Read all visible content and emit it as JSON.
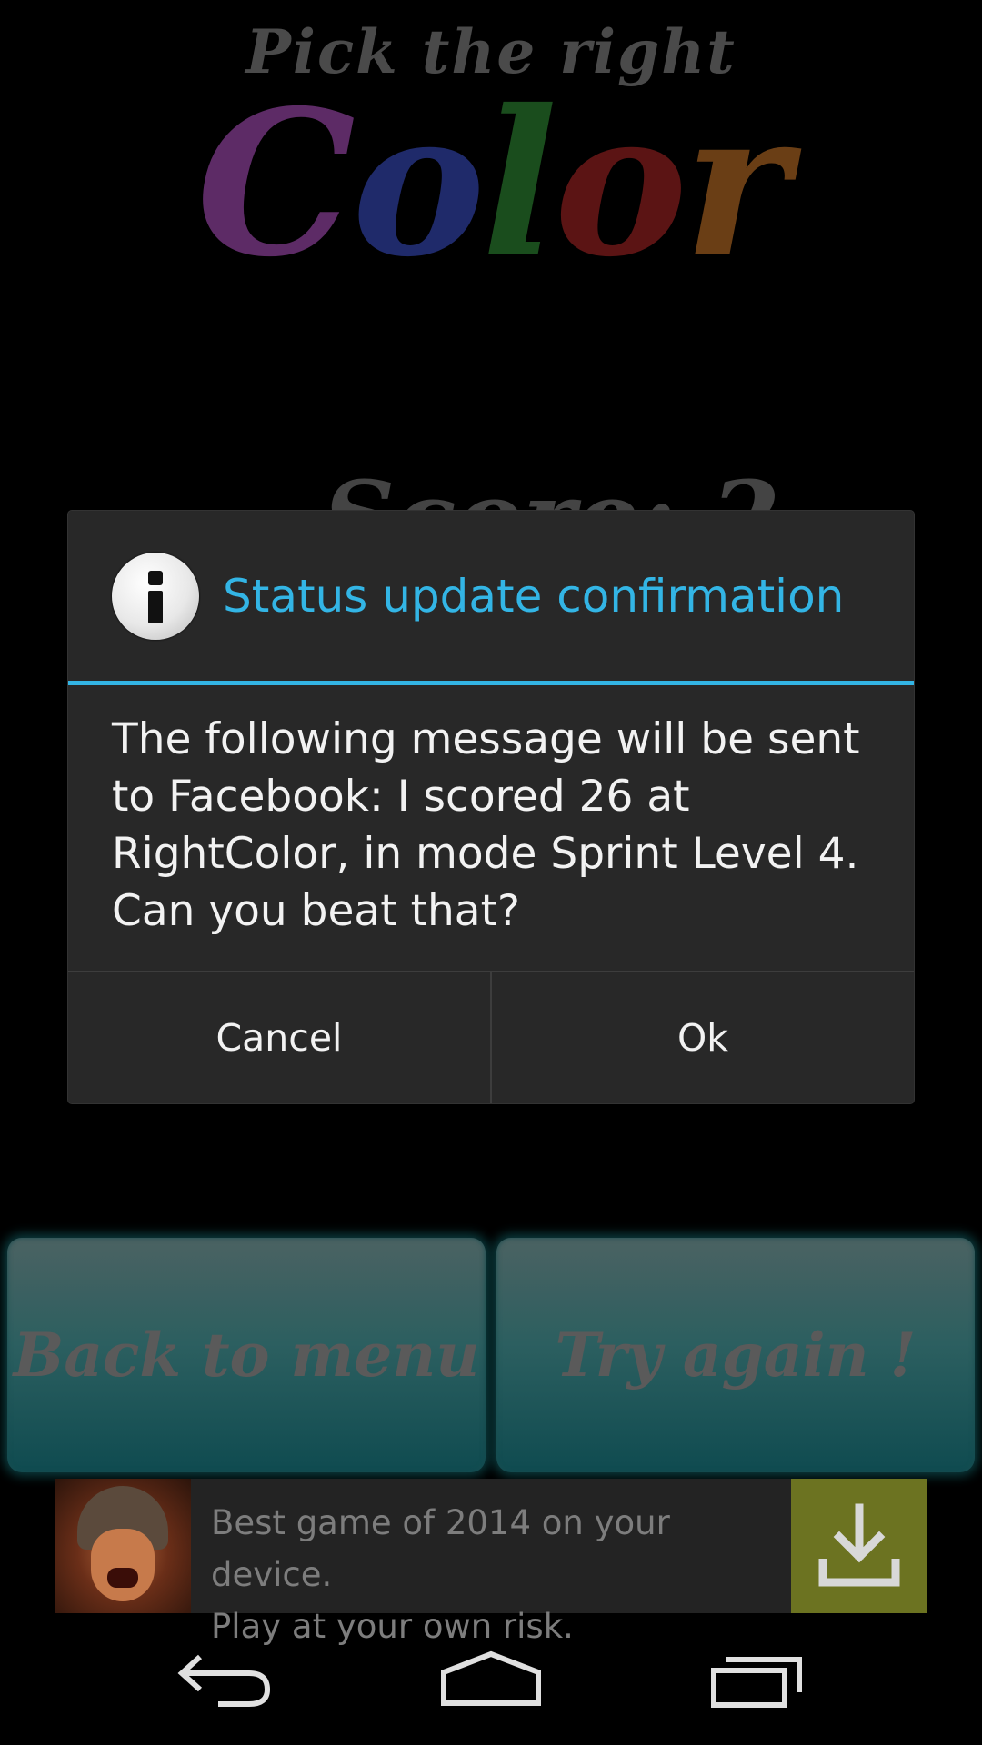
{
  "app": {
    "title_small": "Pick the right",
    "title_letters": [
      {
        "char": "C",
        "color": "#5d2b66"
      },
      {
        "char": "o",
        "color": "#1f2a6a"
      },
      {
        "char": "l",
        "color": "#1a4d1d"
      },
      {
        "char": "o",
        "color": "#5b1414"
      },
      {
        "char": "r",
        "color": "#6a3e15"
      }
    ],
    "score_peek": "Score: 2"
  },
  "dialog": {
    "icon": "info-icon",
    "title": "Status update confirmation",
    "message": "The following message will be sent to Facebook: I scored 26 at RightColor, in mode Sprint Level 4. Can you beat that?",
    "cancel_label": "Cancel",
    "ok_label": "Ok",
    "accent_color": "#33b5e5"
  },
  "game_buttons": {
    "back_label": "Back to menu",
    "try_label": "Try again !"
  },
  "ad": {
    "line1": "Best game of 2014 on your device.",
    "line2": "Play at your own risk.",
    "download_icon": "download-icon"
  },
  "navbar": {
    "back_icon": "back-icon",
    "home_icon": "home-icon",
    "recents_icon": "recents-icon"
  }
}
